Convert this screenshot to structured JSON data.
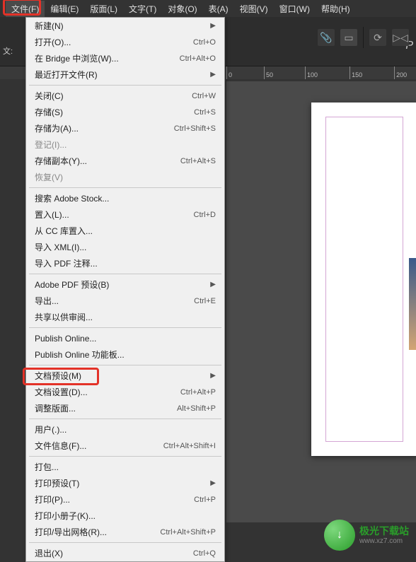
{
  "menubar": {
    "items": [
      {
        "label": "文件(F)",
        "active": true
      },
      {
        "label": "编辑(E)"
      },
      {
        "label": "版面(L)"
      },
      {
        "label": "文字(T)"
      },
      {
        "label": "对象(O)"
      },
      {
        "label": "表(A)"
      },
      {
        "label": "视图(V)"
      },
      {
        "label": "窗口(W)"
      },
      {
        "label": "帮助(H)"
      }
    ]
  },
  "dropdown": {
    "groups": [
      [
        {
          "label": "新建(N)",
          "submenu": true
        },
        {
          "label": "打开(O)...",
          "shortcut": "Ctrl+O"
        },
        {
          "label": "在 Bridge 中浏览(W)...",
          "shortcut": "Ctrl+Alt+O"
        },
        {
          "label": "最近打开文件(R)",
          "submenu": true
        }
      ],
      [
        {
          "label": "关闭(C)",
          "shortcut": "Ctrl+W"
        },
        {
          "label": "存储(S)",
          "shortcut": "Ctrl+S"
        },
        {
          "label": "存储为(A)...",
          "shortcut": "Ctrl+Shift+S"
        },
        {
          "label": "登记(I)...",
          "disabled": true
        },
        {
          "label": "存储副本(Y)...",
          "shortcut": "Ctrl+Alt+S"
        },
        {
          "label": "恢复(V)",
          "disabled": true
        }
      ],
      [
        {
          "label": "搜索 Adobe Stock..."
        },
        {
          "label": "置入(L)...",
          "shortcut": "Ctrl+D"
        },
        {
          "label": "从 CC 库置入..."
        },
        {
          "label": "导入 XML(I)..."
        },
        {
          "label": "导入 PDF 注释..."
        }
      ],
      [
        {
          "label": "Adobe PDF 预设(B)",
          "submenu": true
        },
        {
          "label": "导出...",
          "shortcut": "Ctrl+E"
        },
        {
          "label": "共享以供审阅..."
        }
      ],
      [
        {
          "label": "Publish Online..."
        },
        {
          "label": "Publish Online 功能板..."
        }
      ],
      [
        {
          "label": "文档预设(M)",
          "submenu": true
        },
        {
          "label": "文档设置(D)...",
          "shortcut": "Ctrl+Alt+P"
        },
        {
          "label": "调整版面...",
          "shortcut": "Alt+Shift+P"
        }
      ],
      [
        {
          "label": "用户(.)..."
        },
        {
          "label": "文件信息(F)...",
          "shortcut": "Ctrl+Alt+Shift+I"
        }
      ],
      [
        {
          "label": "打包..."
        },
        {
          "label": "打印预设(T)",
          "submenu": true
        },
        {
          "label": "打印(P)...",
          "shortcut": "Ctrl+P"
        },
        {
          "label": "打印小册子(K)..."
        },
        {
          "label": "打印/导出网格(R)...",
          "shortcut": "Ctrl+Alt+Shift+P"
        }
      ],
      [
        {
          "label": "退出(X)",
          "shortcut": "Ctrl+Q"
        }
      ]
    ]
  },
  "ruler": {
    "ticks": [
      "0",
      "50",
      "100",
      "150",
      "200"
    ]
  },
  "sidelabel": "文:",
  "plabel": "P",
  "logo": {
    "icon": "↓",
    "title": "极光下载站",
    "sub": "www.xz7.com"
  }
}
